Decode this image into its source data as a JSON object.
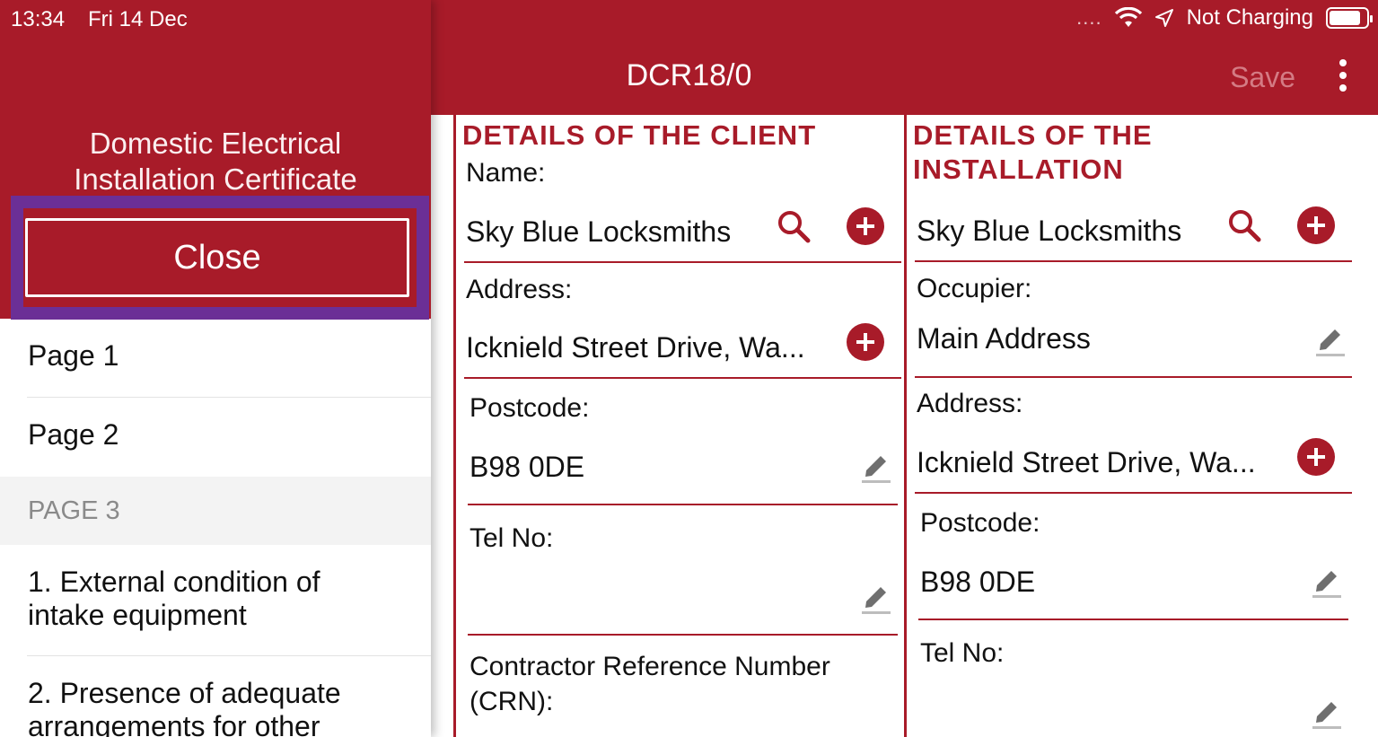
{
  "status_bar": {
    "time": "13:34",
    "date": "Fri 14 Dec",
    "signal_dots": "....",
    "charging": "Not Charging",
    "battery_level": 0.85
  },
  "nav": {
    "title": "DCR18/0",
    "save_label": "Save"
  },
  "drawer": {
    "title_line1": "Domestic Electrical",
    "title_line2": "Installation Certificate",
    "close_label": "Close",
    "items": [
      {
        "label": "Page 1"
      },
      {
        "label": "Page 2"
      }
    ],
    "section_header": "PAGE 3",
    "sub_items": [
      {
        "line1": "1. External condition of",
        "line2": "intake equipment"
      },
      {
        "line1": "2. Presence of adequate",
        "line2": "arrangements for other"
      }
    ]
  },
  "client": {
    "section_title": "DETAILS OF THE CLIENT",
    "name_label": "Name:",
    "name_value": "Sky Blue Locksmiths",
    "address_label": "Address:",
    "address_value": "Icknield Street Drive, Wa...",
    "postcode_label": "Postcode:",
    "postcode_value": "B98 0DE",
    "tel_label": "Tel No:",
    "tel_value": "",
    "crn_label_line1": "Contractor Reference Number",
    "crn_label_line2": "(CRN):"
  },
  "installation": {
    "section_title_line1": "DETAILS OF THE",
    "section_title_line2": "INSTALLATION",
    "name_value": "Sky Blue Locksmiths",
    "occupier_label": "Occupier:",
    "occupier_value": "Main Address",
    "address_label": "Address:",
    "address_value": "Icknield Street Drive, Wa...",
    "postcode_label": "Postcode:",
    "postcode_value": "B98 0DE",
    "tel_label": "Tel No:",
    "tel_value": ""
  },
  "colors": {
    "brand": "#a81b29",
    "highlight": "#6b2f96"
  }
}
